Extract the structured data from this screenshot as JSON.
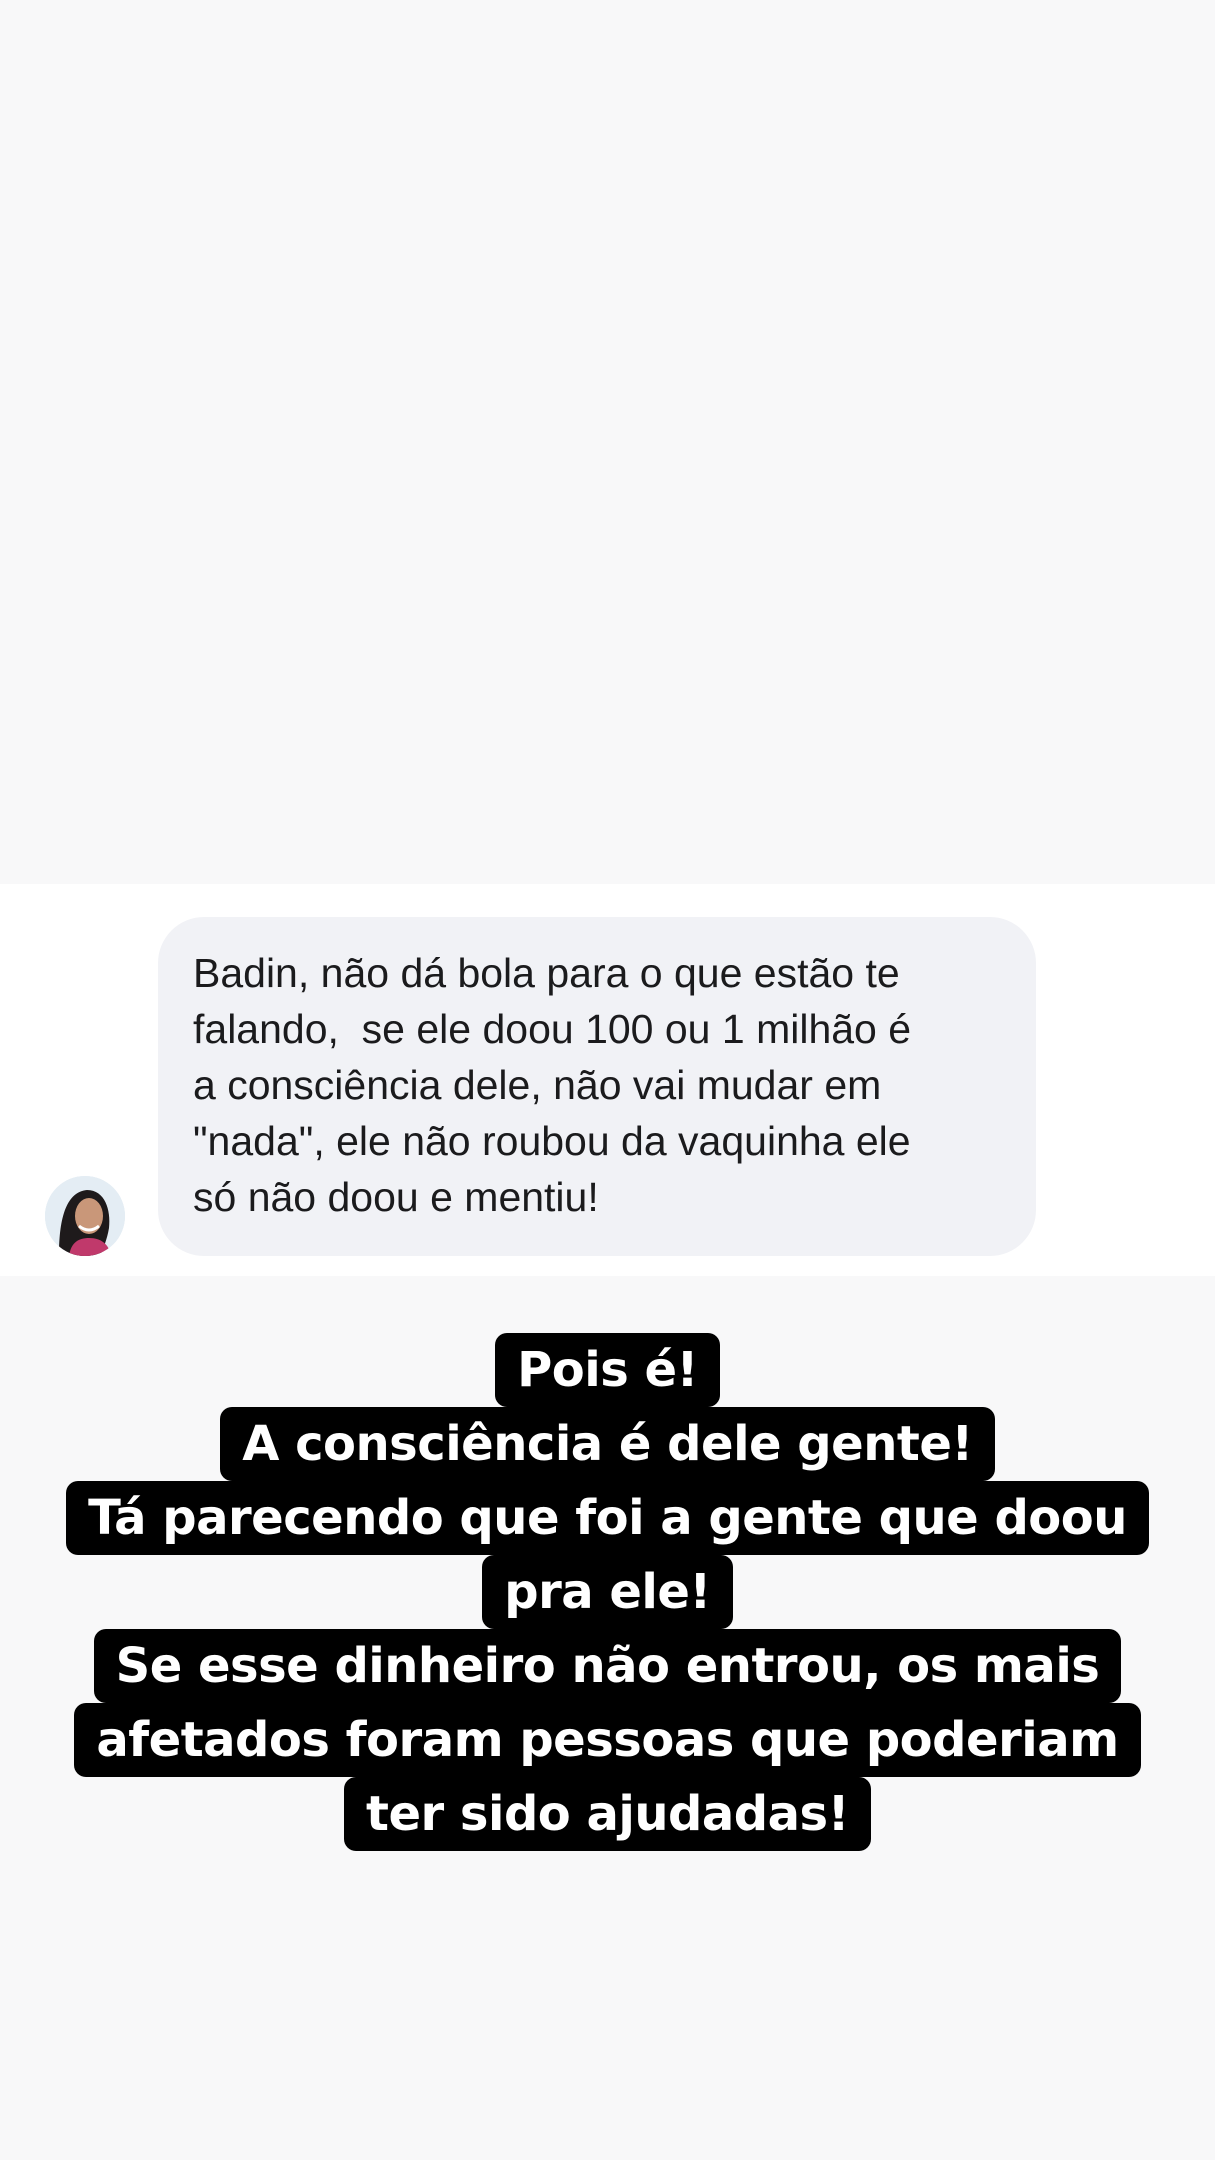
{
  "comment": {
    "avatar_icon": "user-avatar-photo",
    "text": "Badin, não dá bola para o que estão te\nfalando,  se ele doou 100 ou 1 milhão é\na consciência dele, não vai mudar em\n\"nada\", ele não roubou da vaquinha ele\nsó não doou e mentiu!"
  },
  "caption": {
    "lines": [
      "Pois é!",
      "A consciência é dele gente!",
      "Tá parecendo que foi a gente que doou",
      "pra ele!",
      "Se esse dinheiro não entrou, os mais",
      "afetados foram pessoas que poderiam",
      "ter sido ajudadas!"
    ]
  },
  "colors": {
    "background": "#f8f8f9",
    "strip": "#ffffff",
    "bubble": "#f1f2f6",
    "caption_bg": "#000000",
    "caption_text": "#ffffff"
  }
}
